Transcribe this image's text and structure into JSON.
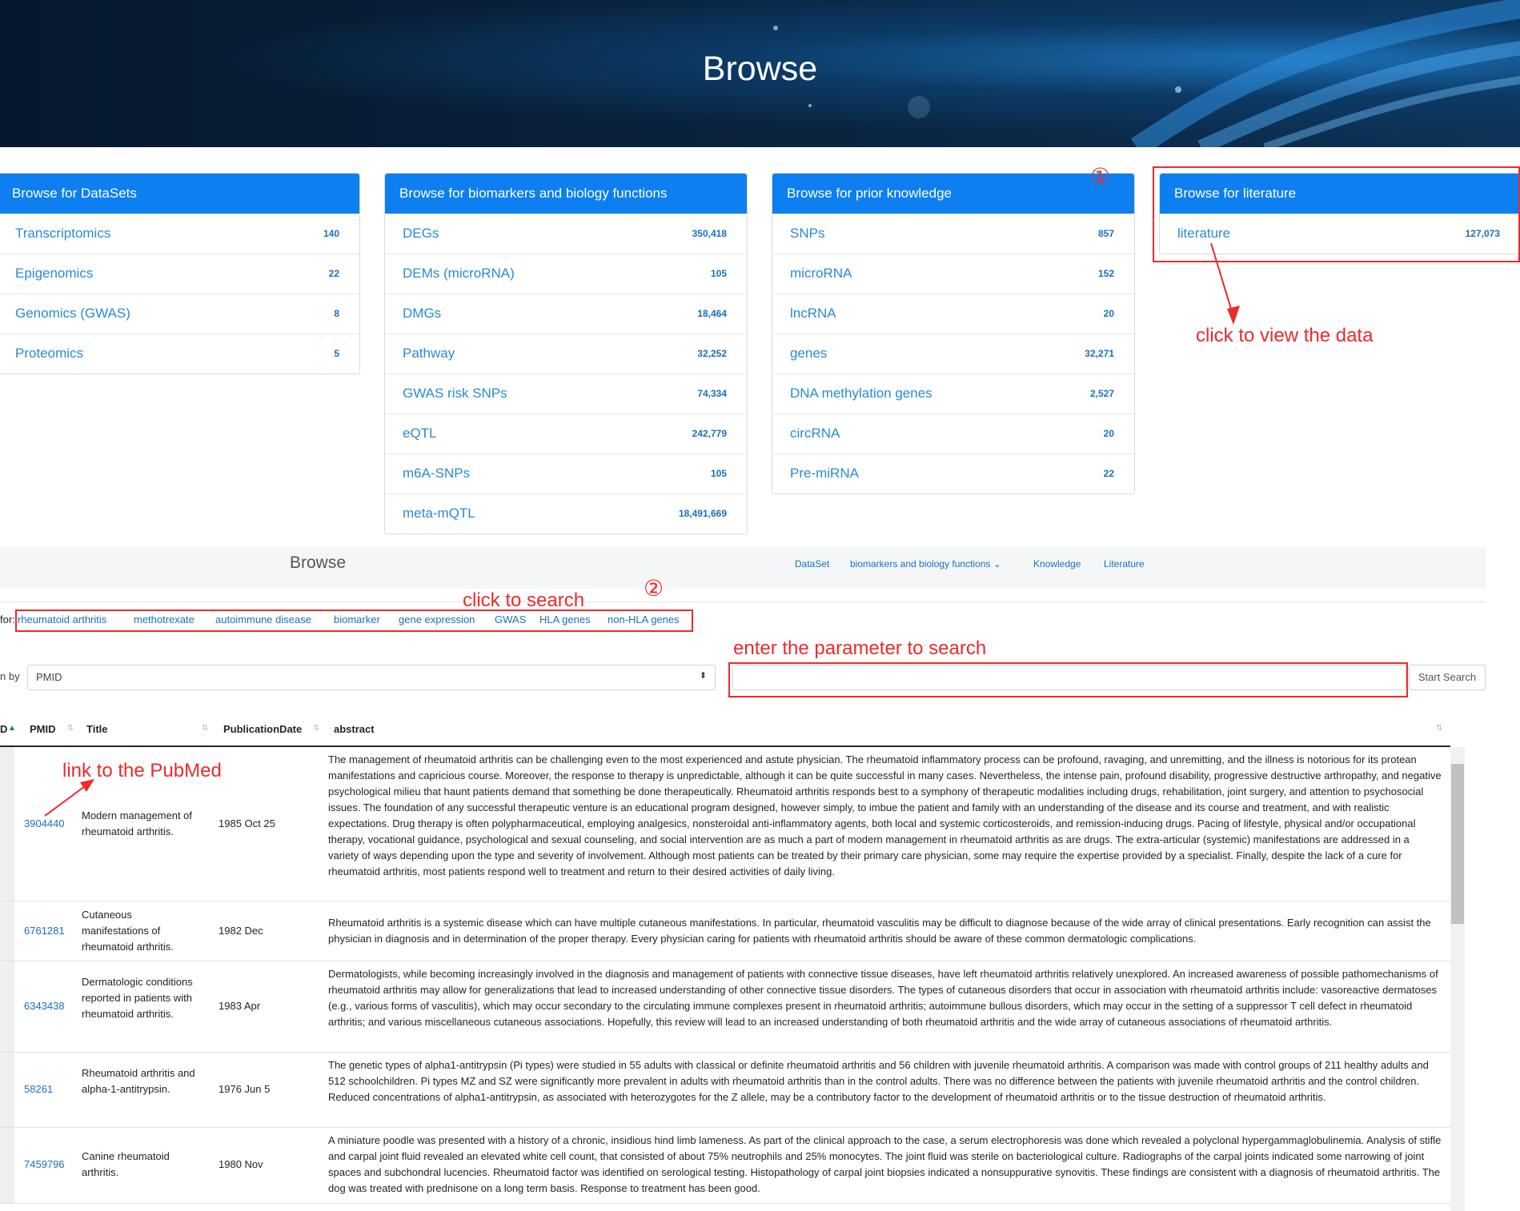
{
  "banner": {
    "title": "Browse"
  },
  "panels": [
    {
      "title": "Browse for DataSets",
      "items": [
        {
          "label": "Transcriptomics",
          "count": "140"
        },
        {
          "label": "Epigenomics",
          "count": "22"
        },
        {
          "label": "Genomics (GWAS)",
          "count": "8"
        },
        {
          "label": "Proteomics",
          "count": "5"
        }
      ]
    },
    {
      "title": "Browse for biomarkers and biology functions",
      "items": [
        {
          "label": "DEGs",
          "count": "350,418"
        },
        {
          "label": "DEMs (microRNA)",
          "count": "105"
        },
        {
          "label": "DMGs",
          "count": "18,464"
        },
        {
          "label": "Pathway",
          "count": "32,252"
        },
        {
          "label": "GWAS risk SNPs",
          "count": "74,334"
        },
        {
          "label": "eQTL",
          "count": "242,779"
        },
        {
          "label": "m6A-SNPs",
          "count": "105"
        },
        {
          "label": "meta-mQTL",
          "count": "18,491,669"
        }
      ]
    },
    {
      "title": "Browse for prior knowledge",
      "items": [
        {
          "label": "SNPs",
          "count": "857"
        },
        {
          "label": "microRNA",
          "count": "152"
        },
        {
          "label": "lncRNA",
          "count": "20"
        },
        {
          "label": "genes",
          "count": "32,271"
        },
        {
          "label": "DNA methylation genes",
          "count": "2,527"
        },
        {
          "label": "circRNA",
          "count": "20"
        },
        {
          "label": "Pre-miRNA",
          "count": "22"
        }
      ]
    },
    {
      "title": "Browse for literature",
      "items": [
        {
          "label": "literature",
          "count": "127,073"
        }
      ]
    }
  ],
  "annotations": {
    "circle1": "①",
    "circle2": "②",
    "click_view": "click to view the data",
    "click_search": "click to search",
    "enter_param": "enter the parameter to search",
    "link_pubmed": "link to the PubMed"
  },
  "nav": {
    "brand": "Browse",
    "links": [
      "DataSet",
      "biomarkers and biology functions ⌄",
      "Knowledge",
      "Literature"
    ]
  },
  "search": {
    "for_label": "for:",
    "keywords": [
      "rheumatoid arthritis",
      "methotrexate",
      "autoimmune disease",
      "biomarker",
      "gene expression",
      "GWAS",
      "HLA genes",
      "non-HLA genes"
    ],
    "by_label": "n by",
    "selected": "PMID",
    "button": "Start Search"
  },
  "table": {
    "headers": [
      "D",
      "PMID",
      "Title",
      "PublicationDate",
      "abstract"
    ],
    "rows": [
      {
        "pmid": "3904440",
        "title": "Modern management of rheumatoid arthritis.",
        "date": "1985 Oct 25",
        "abstract": "The management of rheumatoid arthritis can be challenging even to the most experienced and astute physician. The rheumatoid inflammatory process can be profound, ravaging, and unremitting, and the illness is notorious for its protean manifestations and capricious course. Moreover, the response to therapy is unpredictable, although it can be quite successful in many cases. Nevertheless, the intense pain, profound disability, progressive destructive arthropathy, and negative psychological milieu that haunt patients demand that something be done therapeutically. Rheumatoid arthritis responds best to a symphony of therapeutic modalities including drugs, rehabilitation, joint surgery, and attention to psychosocial issues. The foundation of any successful therapeutic venture is an educational program designed, however simply, to imbue the patient and family with an understanding of the disease and its course and treatment, and with realistic expectations. Drug therapy is often polypharmaceutical, employing analgesics, nonsteroidal anti-inflammatory agents, both local and systemic corticosteroids, and remission-inducing drugs. Pacing of lifestyle, physical and/or occupational therapy, vocational guidance, psychological and sexual counseling, and social intervention are as much a part of modern management in rheumatoid arthritis as are drugs. The extra-articular (systemic) manifestations are addressed in a variety of ways depending upon the type and severity of involvement. Although most patients can be treated by their primary care physician, some may require the expertise provided by a specialist. Finally, despite the lack of a cure for rheumatoid arthritis, most patients respond well to treatment and return to their desired activities of daily living."
      },
      {
        "pmid": "6761281",
        "title": "Cutaneous manifestations of rheumatoid arthritis.",
        "date": "1982 Dec",
        "abstract": "Rheumatoid arthritis is a systemic disease which can have multiple cutaneous manifestations. In particular, rheumatoid vasculitis may be difficult to diagnose because of the wide array of clinical presentations. Early recognition can assist the physician in diagnosis and in determination of the proper therapy. Every physician caring for patients with rheumatoid arthritis should be aware of these common dermatologic complications."
      },
      {
        "pmid": "6343438",
        "title": "Dermatologic conditions reported in patients with rheumatoid arthritis.",
        "date": "1983 Apr",
        "abstract": "Dermatologists, while becoming increasingly involved in the diagnosis and management of patients with connective tissue diseases, have left rheumatoid arthritis relatively unexplored. An increased awareness of possible pathomechanisms of rheumatoid arthritis may allow for generalizations that lead to increased understanding of other connective tissue disorders. The types of cutaneous disorders that occur in association with rheumatoid arthritis include: vasoreactive dermatoses (e.g., various forms of vasculitis), which may occur secondary to the circulating immune complexes present in rheumatoid arthritis; autoimmune bullous disorders, which may occur in the setting of a suppressor T cell defect in rheumatoid arthritis; and various miscellaneous cutaneous associations. Hopefully, this review will lead to an increased understanding of both rheumatoid arthritis and the wide array of cutaneous associations of rheumatoid arthritis."
      },
      {
        "pmid": "58261",
        "title": "Rheumatoid arthritis and alpha-1-antitrypsin.",
        "date": "1976 Jun 5",
        "abstract": "The genetic types of alpha1-antitrypsin (Pi types) were studied in 55 adults with classical or definite rheumatoid arthritis and 56 children with juvenile rheumatoid arthritis. A comparison was made with control groups of 211 healthy adults and 512 schoolchildren. Pi types MZ and SZ were significantly more prevalent in adults with rheumatoid arthritis than in the control adults. There was no difference between the patients with juvenile rheumatoid arthritis and the control children. Reduced concentrations of alpha1-antitrypsin, as associated with heterozygotes for the Z allele, may be a contributory factor to the development of rheumatoid arthritis or to the tissue destruction of rheumatoid arthritis."
      },
      {
        "pmid": "7459796",
        "title": "Canine rheumatoid arthritis.",
        "date": "1980 Nov",
        "abstract": "A miniature poodle was presented with a history of a chronic, insidious hind limb lameness. As part of the clinical approach to the case, a serum electrophoresis was done which revealed a polyclonal hypergammaglobulinemia. Analysis of stifle and carpal joint fluid revealed an elevated white cell count, that consisted of about 75% neutrophils and 25% monocytes. The joint fluid was sterile on bacteriological culture. Radiographs of the carpal joints indicated some narrowing of joint spaces and subchondral lucencies. Rheumatoid factor was identified on serological testing. Histopathology of carpal joint biopsies indicated a nonsuppurative synovitis. These findings are consistent with a diagnosis of rheumatoid arthritis. The dog was treated with prednisone on a long term basis. Response to treatment has been good."
      }
    ]
  }
}
